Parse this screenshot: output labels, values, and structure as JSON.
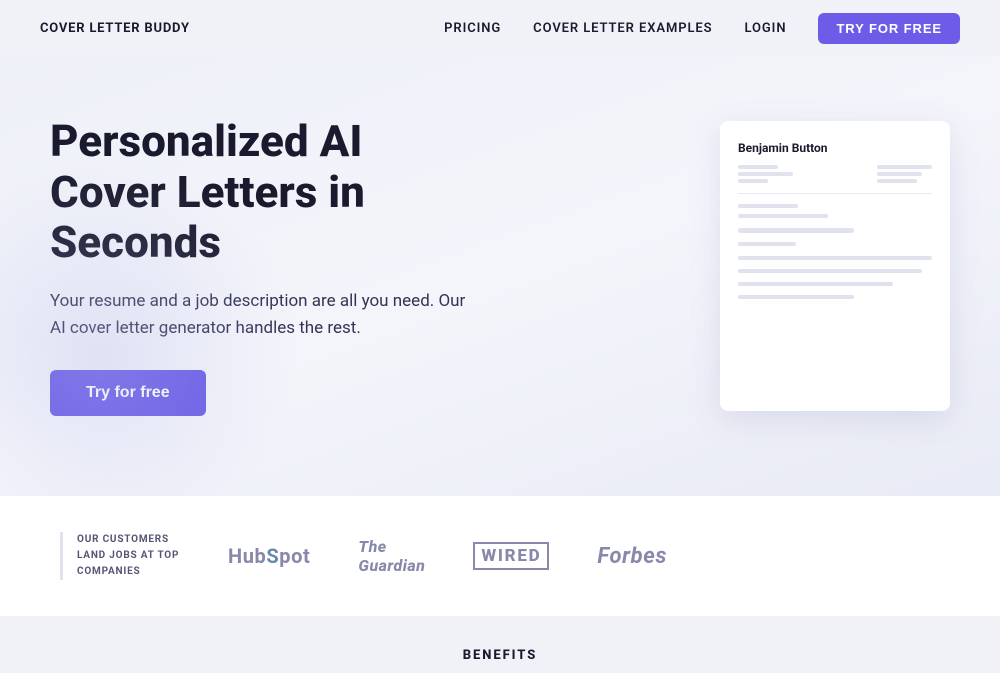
{
  "navbar": {
    "logo": "COVER LETTER BUDDY",
    "links": [
      {
        "id": "pricing",
        "label": "PRICING"
      },
      {
        "id": "examples",
        "label": "COVER LETTER EXAMPLES"
      },
      {
        "id": "login",
        "label": "LOGIN"
      }
    ],
    "cta_label": "TRY FOR FREE"
  },
  "hero": {
    "title": "Personalized AI Cover Letters in Seconds",
    "subtitle": "Your resume and a job description are all you need. Our AI cover letter generator handles the rest.",
    "cta_label": "Try for free",
    "card": {
      "name": "Benjamin Button"
    }
  },
  "customers": {
    "label": "OUR CUSTOMERS\nLAND JOBS AT TOP\nCOMPANIES",
    "companies": [
      {
        "id": "hubspot",
        "name": "HubSpot",
        "class": "hubspot"
      },
      {
        "id": "guardian",
        "name": "The Guardian",
        "class": "guardian"
      },
      {
        "id": "wired",
        "name": "WIRED",
        "class": "wired"
      },
      {
        "id": "forbes",
        "name": "Forbes",
        "class": "forbes"
      }
    ]
  },
  "benefits": {
    "title": "BENEFITS"
  }
}
